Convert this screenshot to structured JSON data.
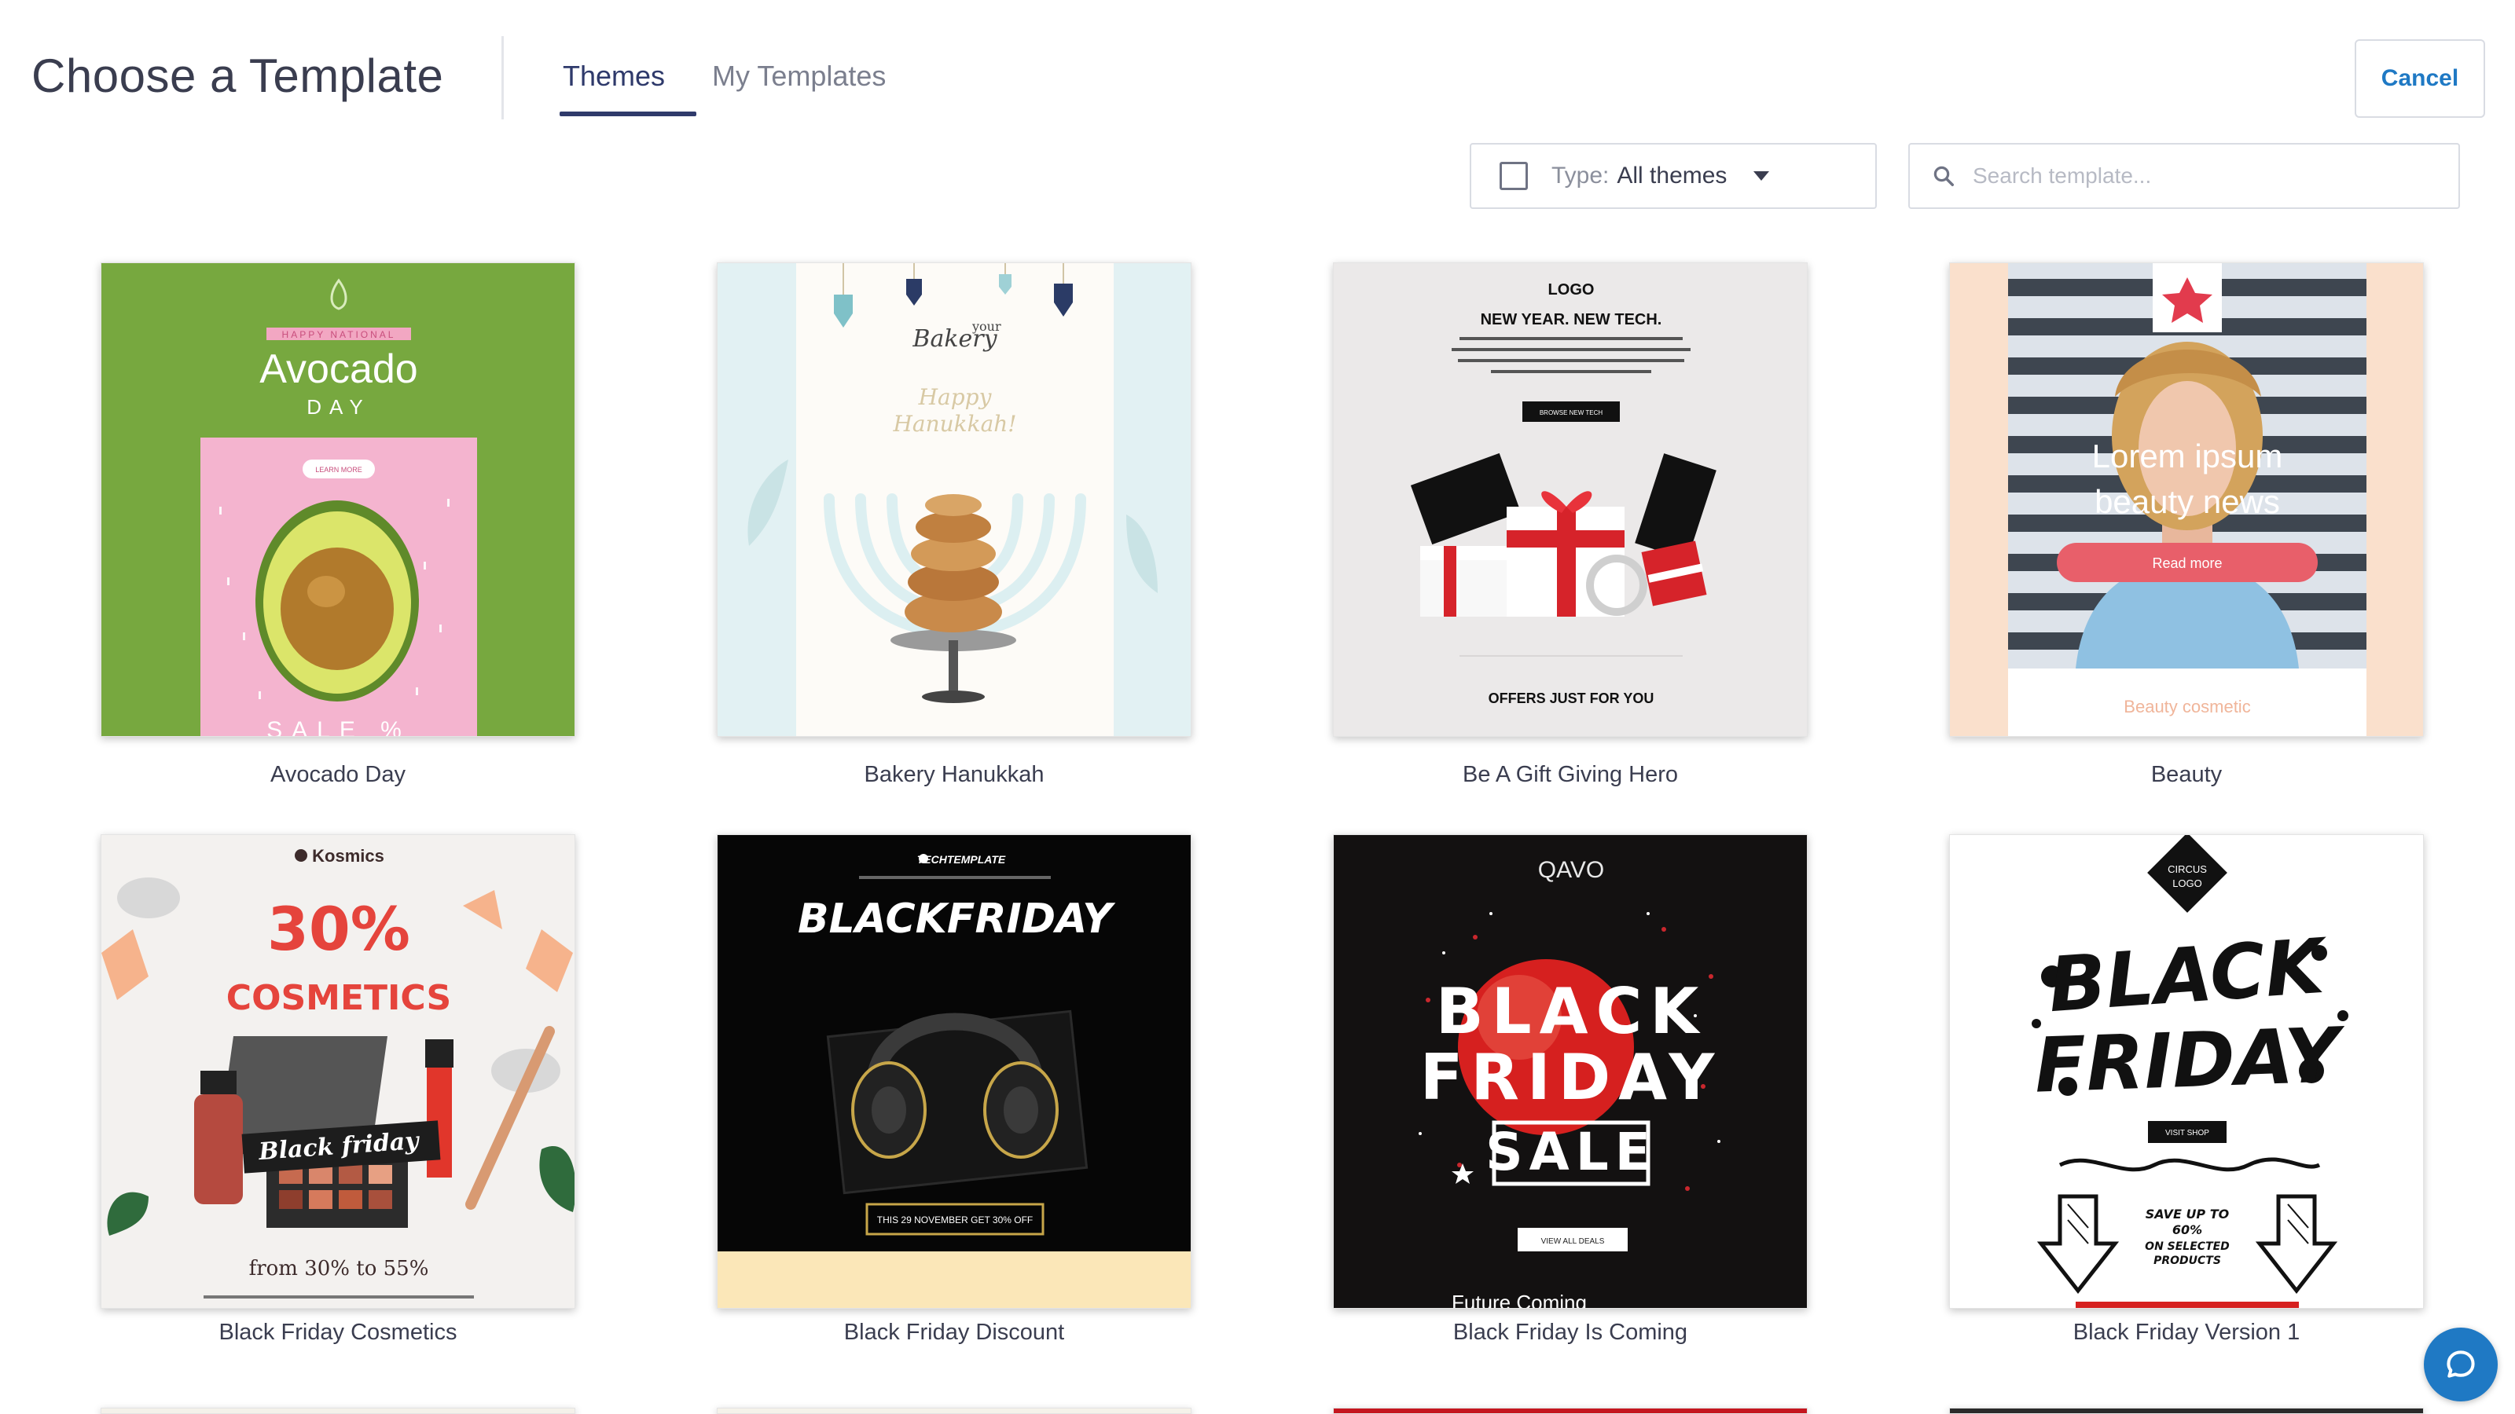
{
  "header": {
    "title": "Choose a Template",
    "tabs": [
      {
        "label": "Themes",
        "active": true
      },
      {
        "label": "My Templates",
        "active": false
      }
    ],
    "cancel_label": "Cancel"
  },
  "filters": {
    "type_label": "Type:",
    "type_value": "All themes",
    "search_placeholder": "Search template..."
  },
  "templates": [
    {
      "name": "Avocado Day",
      "texts": [
        "HAPPY NATIONAL",
        "Avocado",
        "DAY",
        "LEARN MORE",
        "SALE %"
      ]
    },
    {
      "name": "Bakery Hanukkah",
      "texts": [
        "your",
        "Bakery",
        "Happy",
        "Hanukkah!"
      ]
    },
    {
      "name": "Be A Gift Giving Hero",
      "texts": [
        "LOGO",
        "NEW YEAR. NEW TECH.",
        "BROWSE NEW TECH",
        "OFFERS JUST FOR YOU"
      ]
    },
    {
      "name": "Beauty",
      "texts": [
        "Lorem ipsum",
        "beauty news",
        "Read more",
        "Beauty cosmetic"
      ]
    },
    {
      "name": "Black Friday Cosmetics",
      "texts": [
        "Kosmics",
        "30%",
        "COSMETICS",
        "Black friday",
        "from 30% to 55%"
      ]
    },
    {
      "name": "Black Friday Discount",
      "texts": [
        "TECHTEMPLATE",
        "BLACKFRIDAY",
        "THIS 29 NOVEMBER GET 30% OFF"
      ]
    },
    {
      "name": "Black Friday Is Coming",
      "texts": [
        "QAVO",
        "BLACK",
        "FRIDAY",
        "SALE",
        "VIEW ALL DEALS",
        "Future Coming"
      ]
    },
    {
      "name": "Black Friday Version 1",
      "texts": [
        "CIRCUS",
        "LOGO",
        "BLACK",
        "FRIDAY",
        "VISIT SHOP",
        "SAVE UP TO",
        "60%",
        "ON SELECTED",
        "PRODUCTS"
      ]
    }
  ],
  "colors": {
    "accent": "#1f79c4",
    "tab_active": "#2f3a6b",
    "avocado_green": "#77a83f",
    "beauty_button": "#e85f6a"
  },
  "chat": {
    "icon": "chat-bubble-icon"
  }
}
